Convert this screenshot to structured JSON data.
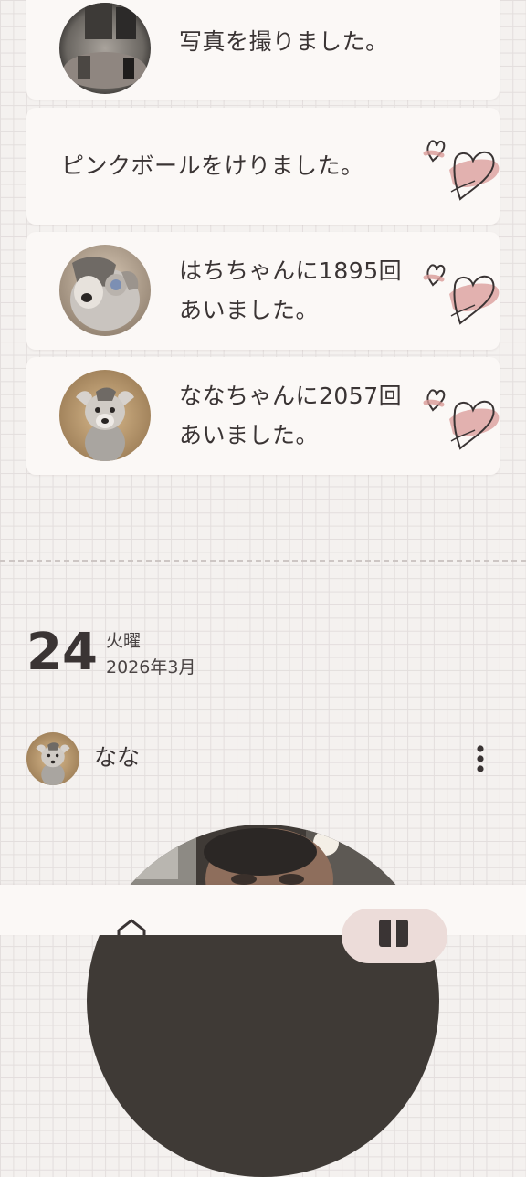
{
  "cards": [
    {
      "text_lines": [
        "写真を撮りました。"
      ],
      "avatar": "photo-thumbnail"
    },
    {
      "text_lines": [
        "ピンクボールをけりました。"
      ],
      "decoration": "hearts-icon"
    },
    {
      "text_lines": [
        "はちちゃんに1895回",
        "あいました。"
      ],
      "avatar": "dog-hachi"
    },
    {
      "text_lines": [
        "ななちゃんに2057回",
        "あいました。"
      ],
      "avatar": "dog-nana"
    }
  ],
  "date": {
    "day": "24",
    "weekday": "火曜",
    "month": "2026年3月"
  },
  "post": {
    "author": "なな",
    "more_icon": "more-vertical-icon"
  },
  "bottom_nav": {
    "items": [
      {
        "icon": "home-icon"
      },
      {
        "icon": "diary-icon"
      }
    ]
  },
  "colors": {
    "background": "#f4f1ef",
    "card": "#fbf8f6",
    "text": "#3a3434",
    "heart_pink": "#d99a97",
    "nav_active": "#ecdcd9"
  }
}
